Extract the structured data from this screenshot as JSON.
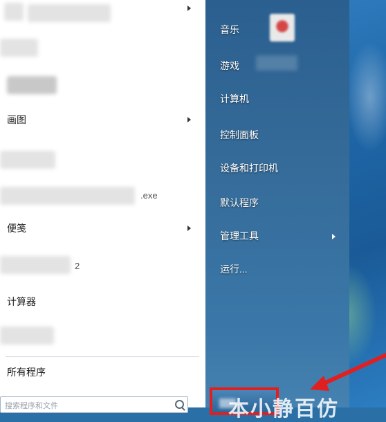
{
  "start_menu": {
    "left_items": [
      {
        "label": "",
        "has_submenu": true
      },
      {
        "label": "",
        "has_submenu": false
      },
      {
        "label": "",
        "has_submenu": false
      },
      {
        "label": "画图",
        "has_submenu": true
      },
      {
        "label": "",
        "has_submenu": false
      },
      {
        "label": ".exe",
        "has_submenu": false
      },
      {
        "label": "便笺",
        "has_submenu": true
      },
      {
        "label": "2",
        "has_submenu": false
      },
      {
        "label": "计算器",
        "has_submenu": false
      },
      {
        "label": "",
        "has_submenu": false
      }
    ],
    "all_programs_label": "所有程序",
    "search_placeholder": "搜索程序和文件",
    "right_items": [
      {
        "label": "音乐"
      },
      {
        "label": "游戏"
      },
      {
        "label": "计算机"
      },
      {
        "label": "控制面板"
      },
      {
        "label": "设备和打印机"
      },
      {
        "label": "默认程序"
      },
      {
        "label": "管理工具",
        "has_submenu": true
      },
      {
        "label": "运行..."
      }
    ]
  },
  "annotation": {
    "highlight_color": "#e21f1f",
    "watermark_text": "本小静百仿"
  }
}
